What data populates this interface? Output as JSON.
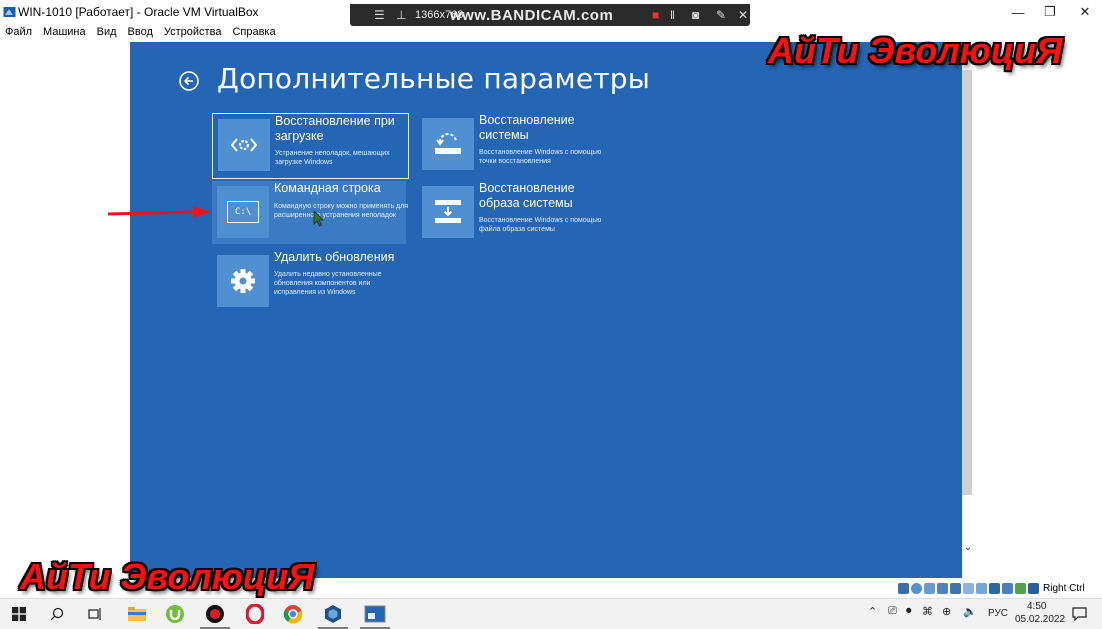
{
  "window": {
    "title": "WIN-1010 [Работает] - Oracle VM VirtualBox",
    "controls": {
      "minimize": "—",
      "maximize": "❐",
      "close": "✕"
    }
  },
  "menu": {
    "items": [
      "Файл",
      "Машина",
      "Вид",
      "Ввод",
      "Устройства",
      "Справка"
    ]
  },
  "bandicam": {
    "resolution": "1366x768",
    "brand": "www.BANDICAM.com"
  },
  "screen": {
    "title": "Дополнительные параметры",
    "tiles": [
      {
        "heading": "Восстановление при загрузке",
        "desc": "Устранение неполадок, мешающих загрузке Windows",
        "icon": "startup-repair-icon"
      },
      {
        "heading": "Восстановление системы",
        "desc": "Восстановление Windows с помощью точки восстановления",
        "icon": "system-restore-icon"
      },
      {
        "heading": "Командная строка",
        "desc": "Командную строку можно применять для расширенного устранения неполадок",
        "icon": "command-prompt-icon",
        "icon_text": "C:\\"
      },
      {
        "heading": "Восстановление образа системы",
        "desc": "Восстановление Windows с помощью файла образа системы",
        "icon": "system-image-icon"
      },
      {
        "heading": "Удалить обновления",
        "desc": "Удалить недавно установленные обновления компонентов или исправления из Windows",
        "icon": "gear-icon"
      }
    ]
  },
  "watermark": "АйТи ЭволюциЯ",
  "statusbar": {
    "host_key": "Right Ctrl"
  },
  "tray": {
    "lang": "РУС",
    "time": "4:50",
    "date": "05.02.2022"
  },
  "colors": {
    "vm_bg": "#2466b4",
    "tile_icon": "#4f8fd2",
    "arrow": "#e8161b"
  }
}
